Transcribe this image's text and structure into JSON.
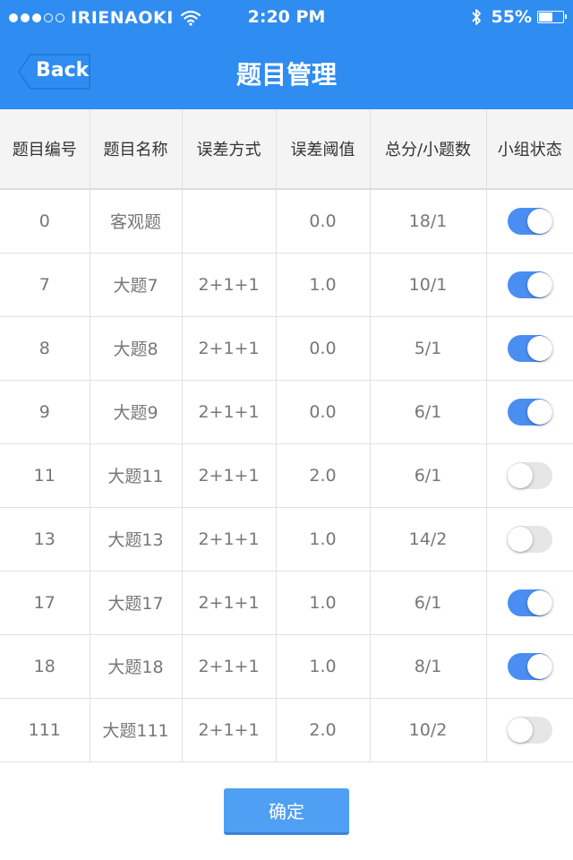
{
  "status_bar": {
    "carrier": "IRIENAOKI",
    "time": "2:20 PM",
    "battery_percent": "55%",
    "battery_level": 0.55,
    "signal_bars_filled": 3,
    "signal_bars_total": 5
  },
  "nav": {
    "back_label": "Back",
    "title": "题目管理"
  },
  "table": {
    "headers": [
      "题目编号",
      "题目名称",
      "误差方式",
      "误差阈值",
      "总分/小题数",
      "小组状态"
    ],
    "rows": [
      {
        "id": "0",
        "name": "客观题",
        "error_mode": "",
        "threshold": "0.0",
        "score": "18/1",
        "group_on": true
      },
      {
        "id": "7",
        "name": "大题7",
        "error_mode": "2+1+1",
        "threshold": "1.0",
        "score": "10/1",
        "group_on": true
      },
      {
        "id": "8",
        "name": "大题8",
        "error_mode": "2+1+1",
        "threshold": "0.0",
        "score": "5/1",
        "group_on": true
      },
      {
        "id": "9",
        "name": "大题9",
        "error_mode": "2+1+1",
        "threshold": "0.0",
        "score": "6/1",
        "group_on": true
      },
      {
        "id": "11",
        "name": "大题11",
        "error_mode": "2+1+1",
        "threshold": "2.0",
        "score": "6/1",
        "group_on": false
      },
      {
        "id": "13",
        "name": "大题13",
        "error_mode": "2+1+1",
        "threshold": "1.0",
        "score": "14/2",
        "group_on": false
      },
      {
        "id": "17",
        "name": "大题17",
        "error_mode": "2+1+1",
        "threshold": "1.0",
        "score": "6/1",
        "group_on": true
      },
      {
        "id": "18",
        "name": "大题18",
        "error_mode": "2+1+1",
        "threshold": "1.0",
        "score": "8/1",
        "group_on": true
      },
      {
        "id": "111",
        "name": "大题111",
        "error_mode": "2+1+1",
        "threshold": "2.0",
        "score": "10/2",
        "group_on": false
      }
    ]
  },
  "footer": {
    "confirm_label": "确定"
  },
  "colors": {
    "primary": "#2f8cf0",
    "toggle_on": "#4a8ef2",
    "toggle_off": "#e6e6e6",
    "button": "#4f9ff5"
  },
  "icons": {
    "wifi": "wifi-icon",
    "bluetooth": "bluetooth-icon",
    "battery": "battery-icon",
    "back": "back-chevron-icon"
  }
}
